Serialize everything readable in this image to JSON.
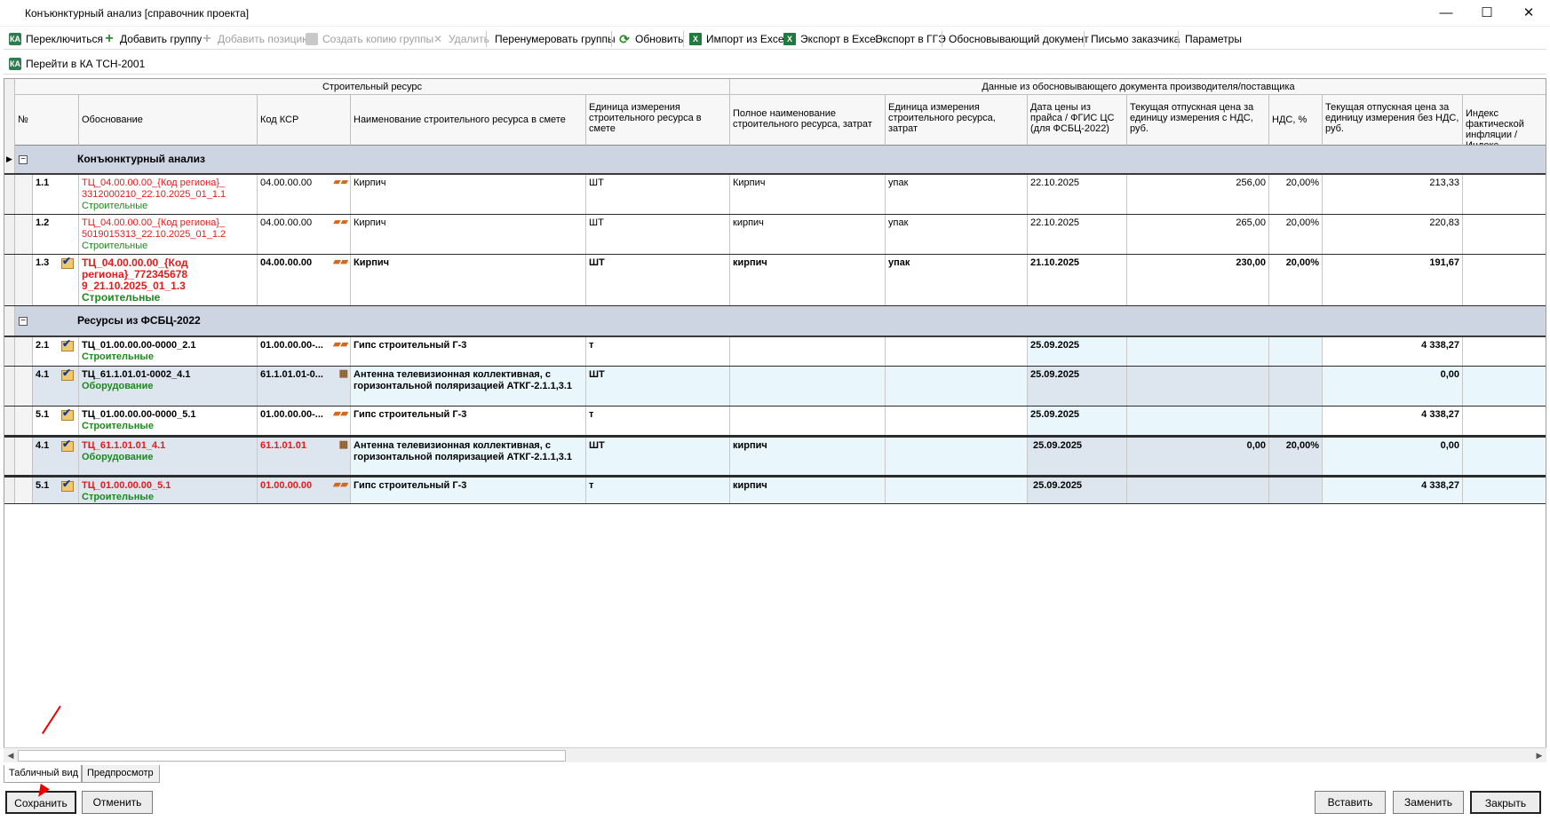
{
  "window": {
    "title": "Конъюнктурный анализ [справочник проекта]",
    "min_glyph": "—",
    "max_glyph": "☐",
    "close_glyph": "✕"
  },
  "toolbar1": [
    {
      "label": "Переключиться",
      "icon": "switch-icon",
      "enabled": true
    },
    {
      "label": "Добавить группу",
      "icon": "plus-icon",
      "enabled": true
    },
    {
      "label": "Добавить позицию",
      "icon": "plus-icon",
      "enabled": false
    },
    {
      "label": "Создать копию группы",
      "icon": "copy-icon",
      "enabled": false
    },
    {
      "label": "Удалить",
      "icon": "delete-icon",
      "enabled": false
    },
    {
      "label": "Перенумеровать группы",
      "icon": "",
      "enabled": true
    },
    {
      "label": "Обновить",
      "icon": "refresh-icon",
      "enabled": true
    },
    {
      "label": "Импорт из Excel",
      "icon": "excel-icon",
      "enabled": true
    },
    {
      "label": "Экспорт в Excel",
      "icon": "excel-icon",
      "enabled": true
    },
    {
      "label": "Экспорт в ГГЭ",
      "icon": "",
      "enabled": true
    },
    {
      "label": "Обосновывающий документ",
      "icon": "",
      "enabled": true
    },
    {
      "label": "Письмо заказчика",
      "icon": "",
      "enabled": true
    },
    {
      "label": "Параметры",
      "icon": "",
      "enabled": true
    }
  ],
  "toolbar2": [
    {
      "label": "Перейти в КА ТСН-2001",
      "icon": "switch-icon",
      "enabled": true
    }
  ],
  "grid": {
    "group_headers": {
      "resource": "Строительный ресурс",
      "document": "Данные из обосновывающего документа производителя/поставщика"
    },
    "columns": {
      "num": "№",
      "basis": "Обоснование",
      "ksr": "Код КСР",
      "name": "Наименование строительного ресурса в смете",
      "unit": "Единица измерения строительного ресурса в смете",
      "full_name": "Полное наименование строительного ресурса, затрат",
      "doc_unit": "Единица измерения строительного ресурса, затрат",
      "date": "Дата цены из прайса / ФГИС ЦС (для ФСБЦ-2022)",
      "price_vat": "Текущая отпускная цена за единицу измерения с НДС, руб.",
      "vat": "НДС, %",
      "price_novat": "Текущая отпускная цена за единицу измерения без НДС, руб.",
      "index": "Индекс фактической инфляции / Индекс"
    },
    "groups": [
      {
        "title": "Конъюнктурный анализ",
        "expander": "−",
        "rows": [
          {
            "num": "1.1",
            "checked": false,
            "bold": false,
            "bg": "white",
            "basis": "ТЦ_04.00.00.00_{Код региона}_ 3312000210_22.10.2025_01_1.1",
            "category": "Строительные",
            "ksr": "04.00.00.00",
            "ksr_red": false,
            "res_icon": "brick-icon",
            "name": "Кирпич",
            "unit": "ШТ",
            "full_name": "Кирпич",
            "doc_unit": "упак",
            "date": "22.10.2025",
            "price_vat": "256,00",
            "vat": "20,00%",
            "price_novat": "213,33"
          },
          {
            "num": "1.2",
            "checked": false,
            "bold": false,
            "bg": "white",
            "basis": "ТЦ_04.00.00.00_{Код региона}_ 5019015313_22.10.2025_01_1.2",
            "category": "Строительные",
            "ksr": "04.00.00.00",
            "ksr_red": false,
            "res_icon": "brick-icon",
            "name": "Кирпич",
            "unit": "ШТ",
            "full_name": "кирпич",
            "doc_unit": "упак",
            "date": "22.10.2025",
            "price_vat": "265,00",
            "vat": "20,00%",
            "price_novat": "220,83"
          },
          {
            "num": "1.3",
            "checked": true,
            "bold": true,
            "bg": "white",
            "basis": "ТЦ_04.00.00.00_{Код региона}_772345678 9_21.10.2025_01_1.3",
            "category": "Строительные",
            "ksr": "04.00.00.00",
            "ksr_red": false,
            "res_icon": "brick-icon",
            "name": "Кирпич",
            "unit": "ШТ",
            "full_name": "кирпич",
            "doc_unit": "упак",
            "date": "21.10.2025",
            "price_vat": "230,00",
            "vat": "20,00%",
            "price_novat": "191,67"
          }
        ]
      },
      {
        "title": "Ресурсы из ФСБЦ-2022",
        "expander": "−",
        "rows": [
          {
            "num": "2.1",
            "checked": true,
            "bold": true,
            "bg": "white",
            "basis": "ТЦ_01.00.00.00-0000_2.1",
            "basis_black": true,
            "category": "Строительные",
            "ksr": "01.00.00.00-...",
            "ksr_red": false,
            "res_icon": "brick-icon",
            "name": "Гипс строительный Г-3",
            "unit": "т",
            "full_name": "",
            "doc_unit": "",
            "date": "25.09.2025",
            "price_vat": "",
            "vat": "",
            "price_novat": "4 338,27"
          },
          {
            "num": "4.1",
            "checked": true,
            "bold": true,
            "bg": "light",
            "basis": "ТЦ_61.1.01.01-0002_4.1",
            "basis_black": true,
            "category": "Оборудование",
            "ksr": "61.1.01.01-0...",
            "ksr_red": false,
            "res_icon": "box-icon",
            "name": "Антенна телевизионная коллективная, с горизонтальной поляризацией АТКГ-2.1.1,3.1",
            "unit": "ШТ",
            "full_name": "",
            "doc_unit": "",
            "date": "25.09.2025",
            "price_vat": "",
            "vat": "",
            "price_novat": "0,00"
          },
          {
            "num": "5.1",
            "checked": true,
            "bold": true,
            "bg": "white",
            "basis": "ТЦ_01.00.00.00-0000_5.1",
            "basis_black": true,
            "category": "Строительные",
            "ksr": "01.00.00.00-...",
            "ksr_red": false,
            "res_icon": "brick-icon",
            "name": "Гипс строительный Г-3",
            "unit": "т",
            "full_name": "",
            "doc_unit": "",
            "date": "25.09.2025",
            "price_vat": "",
            "vat": "",
            "price_novat": "4 338,27"
          },
          {
            "num": "4.1",
            "checked": true,
            "bold": true,
            "bg": "light",
            "basis": "ТЦ_61.1.01.01_4.1",
            "basis_black": false,
            "category": "Оборудование",
            "ksr": "61.1.01.01",
            "ksr_red": true,
            "res_icon": "box-icon",
            "name": "Антенна телевизионная коллективная, с горизонтальной поляризацией АТКГ-2.1.1,3.1",
            "unit": "ШТ",
            "full_name": "кирпич",
            "doc_unit": "",
            "date": "25.09.2025",
            "price_vat": "0,00",
            "vat": "20,00%",
            "price_novat": "0,00"
          },
          {
            "num": "5.1",
            "checked": true,
            "bold": true,
            "bg": "light",
            "basis": "ТЦ_01.00.00.00_5.1",
            "basis_black": false,
            "category": "Строительные",
            "ksr": "01.00.00.00",
            "ksr_red": true,
            "res_icon": "brick-icon",
            "name": "Гипс строительный Г-3",
            "unit": "т",
            "full_name": "кирпич",
            "doc_unit": "",
            "date": "25.09.2025",
            "price_vat": "",
            "vat": "",
            "price_novat": "4 338,27"
          }
        ]
      }
    ]
  },
  "scroll": {
    "left_arrow": "◀",
    "right_arrow": "▶"
  },
  "tabs": [
    {
      "label": "Табличный вид",
      "active": true
    },
    {
      "label": "Предпросмотр",
      "active": false
    }
  ],
  "buttons": {
    "save": "Сохранить",
    "cancel": "Отменить",
    "insert": "Вставить",
    "replace": "Заменить",
    "close": "Закрыть"
  },
  "colors": {
    "accent_red": "#e8191b",
    "category_green": "#1a8a1a",
    "group_row_bg": "#cdd4e2",
    "light_row_bg": "#e9f7fd",
    "annotation_arrow": "#e00000"
  }
}
